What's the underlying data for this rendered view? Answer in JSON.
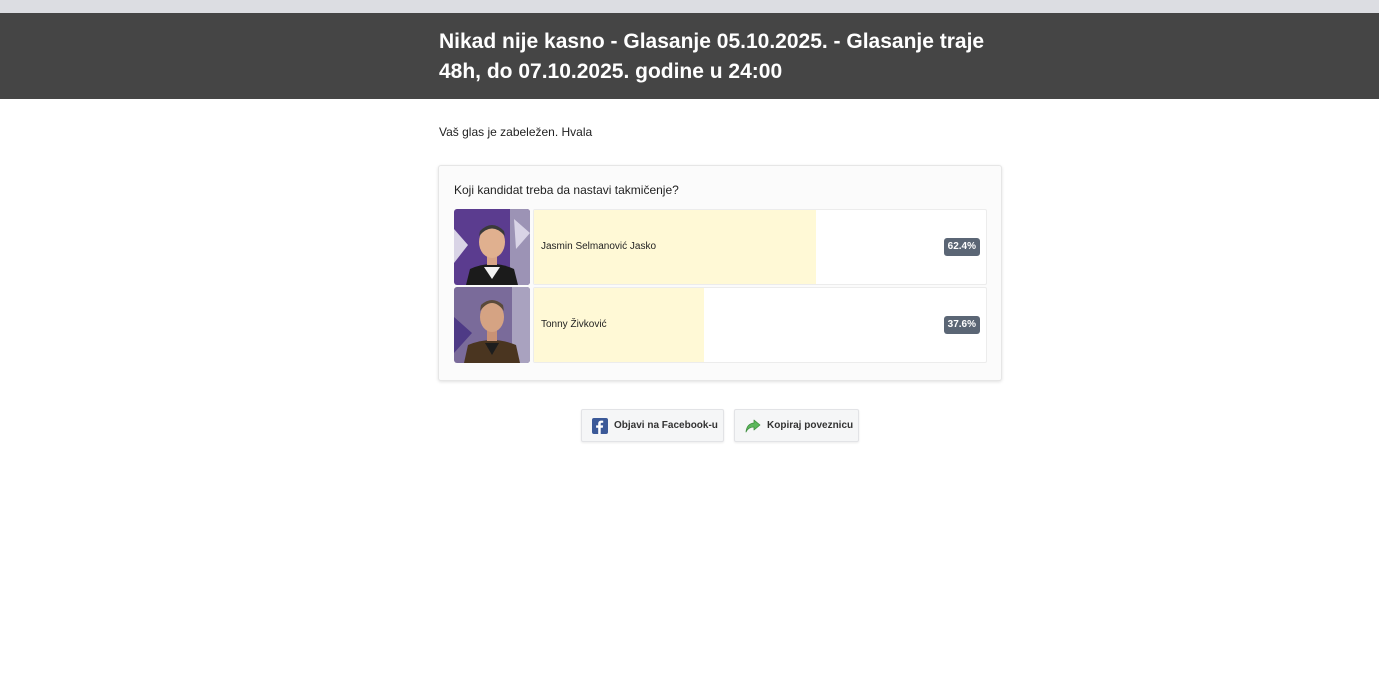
{
  "header": {
    "title_line1": "Nikad nije kasno - Glasanje 05.10.2025. - Glasanje traje",
    "title_line2": "48h, do 07.10.2025. godine u 24:00"
  },
  "message": "Vaš glas je zabeležen. Hvala",
  "poll": {
    "question": "Koji kandidat treba da nastavi takmičenje?",
    "options": [
      {
        "label": "Jasmin Selmanović Jasko",
        "percent_text": "62.4%",
        "fill_percent": 62.4
      },
      {
        "label": "Tonny Živković",
        "percent_text": "37.6%",
        "fill_percent": 37.6
      }
    ]
  },
  "share": {
    "facebook_label": "Objavi na Facebook-u",
    "copy_label": "Kopiraj poveznicu"
  },
  "colors": {
    "header_bg": "#454545",
    "bar_fill": "#fff9d6",
    "badge_bg": "#5b6675",
    "facebook_blue": "#3b5998",
    "share_green": "#5cb85c"
  }
}
